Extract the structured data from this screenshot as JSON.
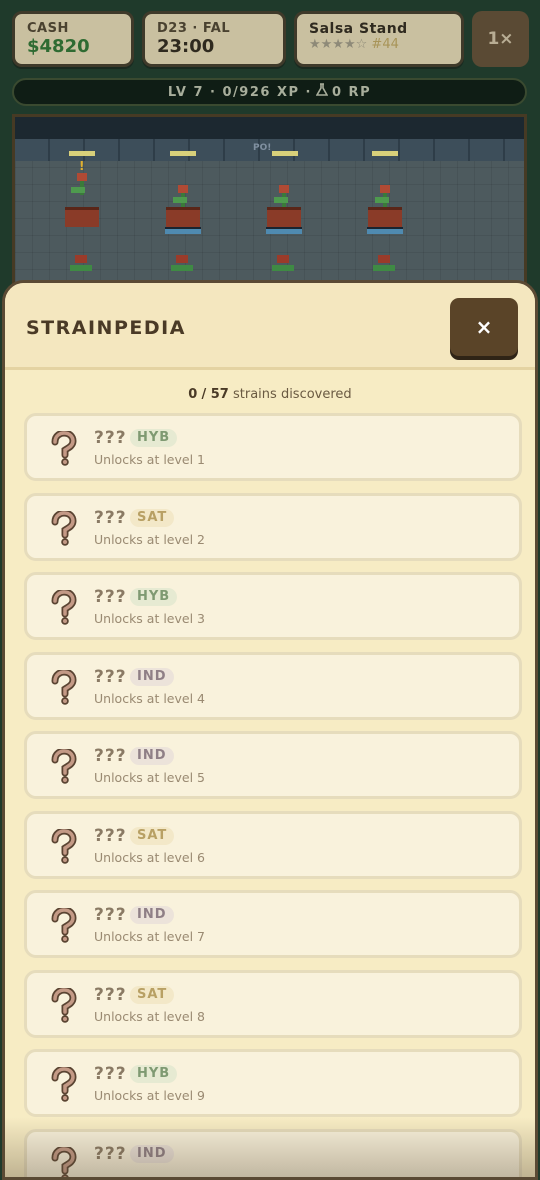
{
  "hud": {
    "cash_label": "CASH",
    "cash_value": "$4820",
    "day_label": "D23 · FAL",
    "time_value": "23:00",
    "stand_name": "Salsa Stand",
    "stand_stars": "★★★★☆",
    "stand_rank": "#44",
    "speed_label": "1×"
  },
  "xp_bar": {
    "text": "LV 7 · 0/926 XP ·",
    "rp_icon": "flask-icon",
    "rp_text": "0 RP"
  },
  "scene": {
    "alert": "!",
    "sign": "PO!"
  },
  "modal": {
    "title": "STRAINPEDIA",
    "close_label": "×",
    "discovered_count": "0",
    "discovered_total": "57",
    "discovered_suffix": "strains discovered",
    "strains": [
      {
        "name": "???",
        "type": "HYB",
        "unlock": "Unlocks at level 1"
      },
      {
        "name": "???",
        "type": "SAT",
        "unlock": "Unlocks at level 2"
      },
      {
        "name": "???",
        "type": "HYB",
        "unlock": "Unlocks at level 3"
      },
      {
        "name": "???",
        "type": "IND",
        "unlock": "Unlocks at level 4"
      },
      {
        "name": "???",
        "type": "IND",
        "unlock": "Unlocks at level 5"
      },
      {
        "name": "???",
        "type": "SAT",
        "unlock": "Unlocks at level 6"
      },
      {
        "name": "???",
        "type": "IND",
        "unlock": "Unlocks at level 7"
      },
      {
        "name": "???",
        "type": "SAT",
        "unlock": "Unlocks at level 8"
      },
      {
        "name": "???",
        "type": "HYB",
        "unlock": "Unlocks at level 9"
      },
      {
        "name": "???",
        "type": "IND",
        "unlock": ""
      }
    ],
    "colors": {
      "hyb": "#7f9a72",
      "sat": "#b8a064",
      "ind": "#8f7f86",
      "panel": "#f7ecc4",
      "accent": "#5a4428"
    }
  }
}
